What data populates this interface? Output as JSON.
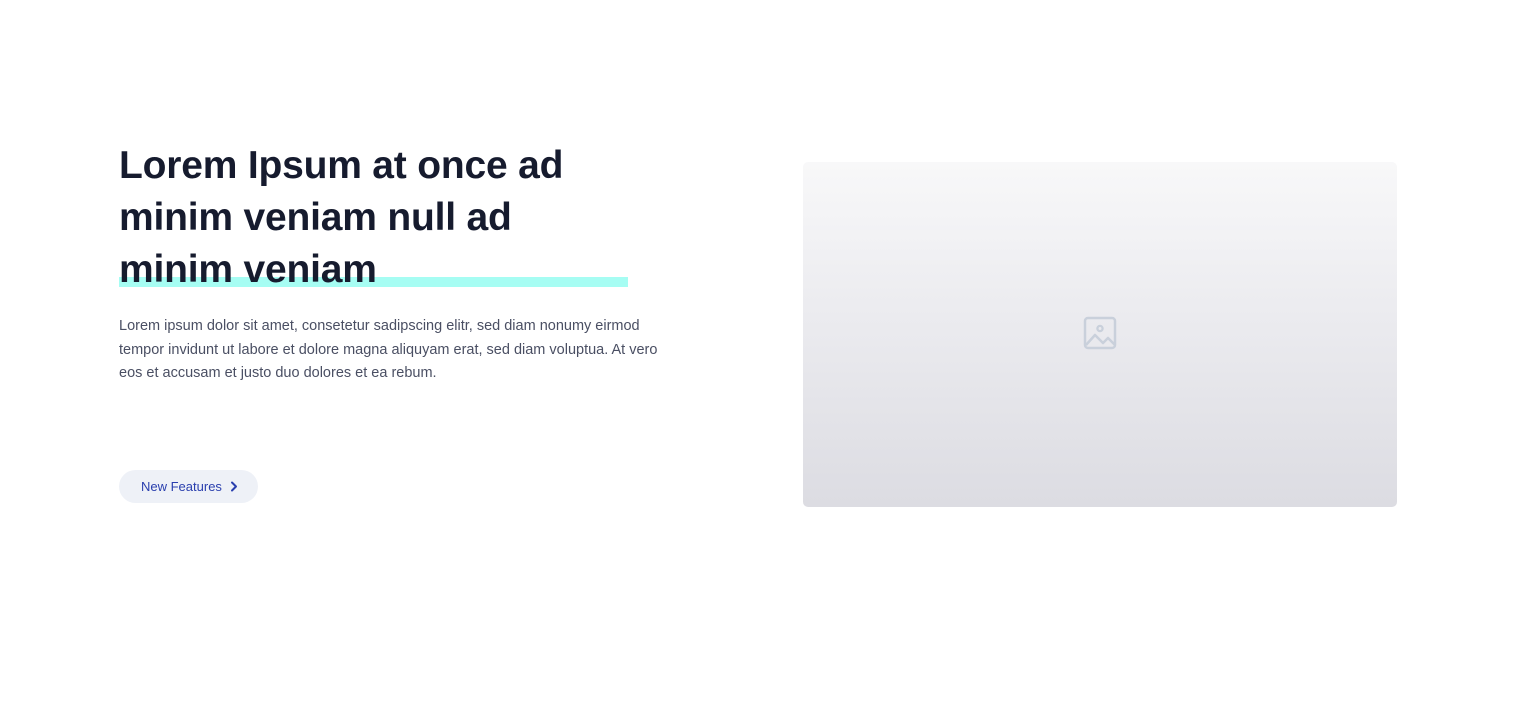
{
  "hero": {
    "headline_lines": [
      "Lorem Ipsum at once ad",
      "minim veniam null ad",
      "minim veniam"
    ],
    "paragraph": "Lorem ipsum dolor sit amet, consetetur sadipscing elitr, sed diam nonumy eirmod tempor invidunt ut labore et dolore magna aliquyam erat, sed diam voluptua. At vero eos et accusam et justo duo dolores et ea rebum.",
    "cta_label": "New Features",
    "cta_icon": "chevron-right-icon",
    "image_placeholder_icon": "image-icon"
  },
  "colors": {
    "headline": "#161b2e",
    "highlight": "#a6fdf3",
    "body_text": "#4a4f63",
    "cta_bg": "#eef1f7",
    "cta_text": "#2a3fae",
    "placeholder_icon": "#c9d0db"
  }
}
